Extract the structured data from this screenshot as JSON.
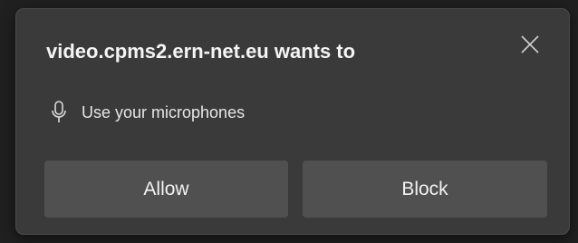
{
  "dialog": {
    "title": "video.cpms2.ern-net.eu wants to",
    "close_icon": "close-icon",
    "permission": {
      "icon": "microphone-icon",
      "text": "Use your microphones"
    },
    "buttons": {
      "allow_label": "Allow",
      "block_label": "Block"
    }
  },
  "colors": {
    "dialog_bg": "#3a3a3a",
    "button_bg": "#505050",
    "text_primary": "#f4f4f4"
  }
}
